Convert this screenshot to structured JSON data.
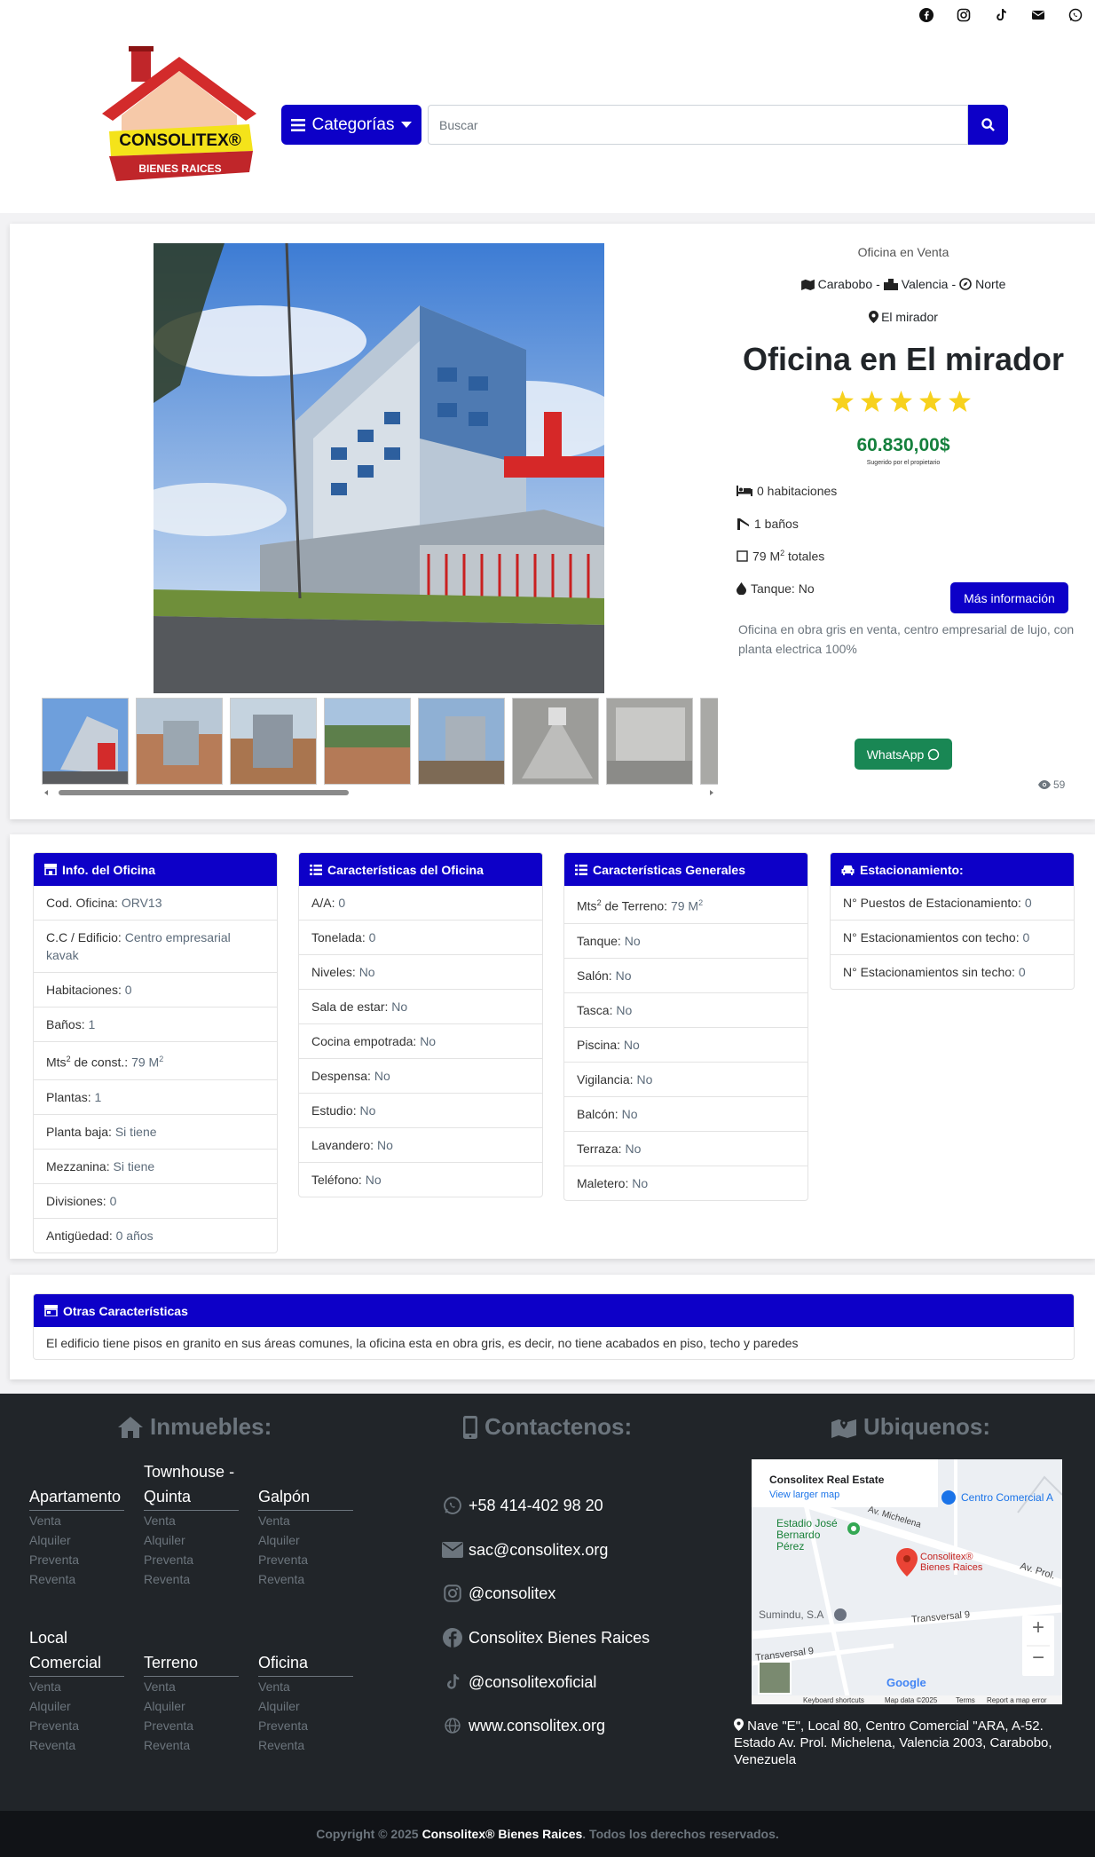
{
  "header": {
    "social_icons": [
      "facebook-icon",
      "instagram-icon",
      "tiktok-icon",
      "envelope-icon",
      "whatsapp-icon"
    ],
    "logo": {
      "brand": "CONSOLITEX®",
      "tagline": "BIENES RAICES"
    },
    "categories_label": "Categorías",
    "search_placeholder": "Buscar"
  },
  "property": {
    "type_label": "Oficina en Venta",
    "state": "Carabobo",
    "city": "Valencia",
    "zone": "Norte",
    "sector": "El mirador",
    "title": "Oficina en El mirador",
    "rating_stars": 5,
    "price": "60.830,00$",
    "price_note": "Sugerido por el propietario",
    "rooms": "0 habitaciones",
    "baths": "1 baños",
    "area_num": "79 M",
    "area_sup": "2",
    "area_tail": " totales",
    "tank": "Tanque: No",
    "more_info_label": "Más información",
    "description": "Oficina en obra gris en venta, centro empresarial de lujo, con planta electrica 100%",
    "whatsapp_label": "WhatsApp",
    "views": "59"
  },
  "panels": {
    "info": {
      "title": "Info. del Oficina",
      "rows": [
        {
          "k": "Cod. Oficina: ",
          "v": "ORV13"
        },
        {
          "k": "C.C / Edificio: ",
          "v": "Centro empresarial kavak"
        },
        {
          "k": "Habitaciones: ",
          "v": "0"
        },
        {
          "k": "Baños: ",
          "v": "1"
        },
        {
          "k": "Mts",
          "sup": "2",
          "k2": " de const.: ",
          "v": "79 M",
          "vsup": "2"
        },
        {
          "k": "Plantas: ",
          "v": "1"
        },
        {
          "k": "Planta baja: ",
          "v": "Si tiene"
        },
        {
          "k": "Mezzanina: ",
          "v": "Si tiene"
        },
        {
          "k": "Divisiones: ",
          "v": "0"
        },
        {
          "k": "Antigüedad: ",
          "v": "0 años"
        }
      ]
    },
    "caract": {
      "title": "Características del Oficina",
      "rows": [
        {
          "k": "A/A: ",
          "v": "0"
        },
        {
          "k": "Tonelada: ",
          "v": "0"
        },
        {
          "k": "Niveles: ",
          "v": "No"
        },
        {
          "k": "Sala de estar: ",
          "v": "No"
        },
        {
          "k": "Cocina empotrada: ",
          "v": "No"
        },
        {
          "k": "Despensa: ",
          "v": "No"
        },
        {
          "k": "Estudio: ",
          "v": "No"
        },
        {
          "k": "Lavandero: ",
          "v": "No"
        },
        {
          "k": "Teléfono: ",
          "v": "No"
        }
      ]
    },
    "generales": {
      "title": "Características Generales",
      "rows": [
        {
          "k": "Mts",
          "sup": "2",
          "k2": " de Terreno: ",
          "v": "79 M",
          "vsup": "2"
        },
        {
          "k": "Tanque: ",
          "v": "No"
        },
        {
          "k": "Salón: ",
          "v": "No"
        },
        {
          "k": "Tasca: ",
          "v": "No"
        },
        {
          "k": "Piscina: ",
          "v": "No"
        },
        {
          "k": "Vigilancia: ",
          "v": "No"
        },
        {
          "k": "Balcón: ",
          "v": "No"
        },
        {
          "k": "Terraza: ",
          "v": "No"
        },
        {
          "k": "Maletero: ",
          "v": "No"
        }
      ]
    },
    "estacionamiento": {
      "title": "Estacionamiento:",
      "rows": [
        {
          "k": "N° Puestos de Estacionamiento: ",
          "v": "0"
        },
        {
          "k": "N° Estacionamientos con techo: ",
          "v": "0"
        },
        {
          "k": "N° Estacionamientos sin techo: ",
          "v": "0"
        }
      ]
    }
  },
  "otras": {
    "title": "Otras Características",
    "text": "El edificio tiene pisos en granito en sus áreas comunes, la oficina esta en obra gris, es decir, no tiene acabados en piso, techo y paredes"
  },
  "footer": {
    "inmuebles_title": "Inmuebles:",
    "contact_title": "Contactenos:",
    "ubiquenos_title": "Ubiquenos:",
    "categories": [
      {
        "name": "Apartamento",
        "links": [
          "Venta",
          "Alquiler",
          "Preventa",
          "Reventa"
        ]
      },
      {
        "name": "Townhouse - Quinta",
        "links": [
          "Venta",
          "Alquiler",
          "Preventa",
          "Reventa"
        ]
      },
      {
        "name": "Galpón",
        "links": [
          "Venta",
          "Alquiler",
          "Preventa",
          "Reventa"
        ]
      },
      {
        "name": "Local Comercial",
        "links": [
          "Venta",
          "Alquiler",
          "Preventa",
          "Reventa"
        ]
      },
      {
        "name": "Terreno",
        "links": [
          "Venta",
          "Alquiler",
          "Preventa",
          "Reventa"
        ]
      },
      {
        "name": "Oficina",
        "links": [
          "Venta",
          "Alquiler",
          "Preventa",
          "Reventa"
        ]
      }
    ],
    "contacts": [
      {
        "icon": "whatsapp-icon",
        "text": "+58 414-402 98 20"
      },
      {
        "icon": "envelope-icon",
        "text": "sac@consolitex.org"
      },
      {
        "icon": "instagram-icon",
        "text": "@consolitex"
      },
      {
        "icon": "facebook-icon",
        "text": "Consolitex Bienes Raices"
      },
      {
        "icon": "tiktok-icon",
        "text": "@consolitexoficial"
      },
      {
        "icon": "globe-icon",
        "text": "www.consolitex.org"
      }
    ],
    "map": {
      "place_name": "Consolitex Real Estate",
      "view_larger": "View larger map",
      "label_cc": "Centro Comercial A",
      "label_estadio": "Estadio José Bernardo Pérez",
      "label_marker": "Consolitex® Bienes Raices",
      "label_sumindu": "Sumindu, S.A",
      "street1": "Transversal 9",
      "street2": "Transversal 9",
      "street3": "Av. Prol.",
      "street4": "Av. Michelena",
      "google": "Google",
      "kb": "Keyboard shortcuts",
      "mapdata": "Map data ©2025",
      "terms": "Terms",
      "report": "Report a map error",
      "zoom_in": "+",
      "zoom_out": "−"
    },
    "address": "Nave \"E\", Local 80, Centro Comercial \"ARA, A-52. Estado Av. Prol. Michelena, Valencia 2003, Carabobo, Venezuela"
  },
  "copyright": {
    "prefix": "Copyright © 2025",
    "brand": "Consolitex® Bienes Raices",
    "suffix": ". Todos los derechos reservados."
  },
  "colors": {
    "primary": "#0d00c8",
    "whatsapp": "#198754",
    "price": "#15803d",
    "footer": "#212529",
    "star": "#f7d11e"
  }
}
